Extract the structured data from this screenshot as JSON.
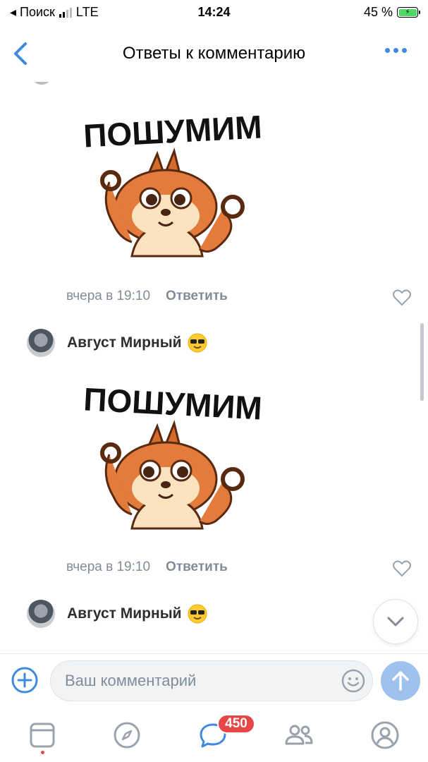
{
  "status_bar": {
    "carrier": "◂ Поиск",
    "network": "LTE",
    "time": "14:24",
    "battery": "45 %"
  },
  "nav": {
    "title": "Ответы к комментарию"
  },
  "stickers": [
    {
      "caption": "ПОШУМИМ"
    },
    {
      "caption": "ПОШУМИМ"
    }
  ],
  "comments": [
    {
      "time": "вчера в 19:10",
      "reply_label": "Ответить"
    },
    {
      "author": "Август Мирный",
      "time": "вчера в 19:10",
      "reply_label": "Ответить"
    },
    {
      "author": "Август Мирный"
    }
  ],
  "composer": {
    "placeholder": "Ваш комментарий"
  },
  "tab_bar": {
    "messages_badge": "450"
  },
  "colors": {
    "accent": "#3f8ae0",
    "secondary_text": "#818c99",
    "badge": "#e64646",
    "sticker_orange": "#e27b3c"
  },
  "icons": [
    "back-chevron-icon",
    "more-dots-icon",
    "heart-icon",
    "smile-icon",
    "chevron-down-icon",
    "plus-circle-icon",
    "send-arrow-icon",
    "news-icon",
    "compass-icon",
    "messages-icon",
    "friends-icon",
    "profile-icon"
  ]
}
